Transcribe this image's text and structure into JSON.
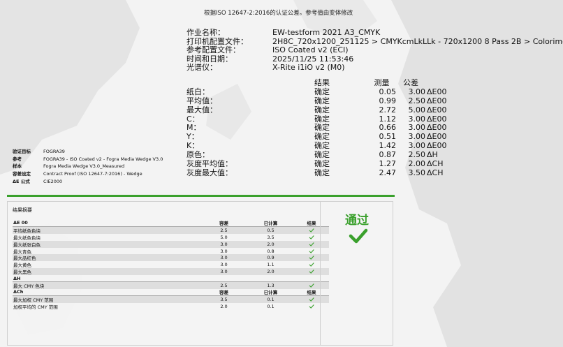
{
  "header_note": "根据ISO 12647-2:2016的认证公差。参考值由变体修改",
  "info": [
    {
      "label": "作业名称：",
      "value": "EW-testform 2021 A3_CMYK"
    },
    {
      "label": "打印机配置文件：",
      "value": "2H8C_720x1200_251125 > CMYKcmLkLLk - 720x1200 8 Pass 2B > Colorimetric"
    },
    {
      "label": "参考配置文件：",
      "value": "ISO Coated v2 (ECI)"
    },
    {
      "label": "时间和日期：",
      "value": "2025/11/25 11:53:46"
    },
    {
      "label": "光谱仪：",
      "value": "X-Rite i1iO v2 (M0)"
    }
  ],
  "measure_header": {
    "result": "结果",
    "measured": "测量",
    "tolerance": "公差"
  },
  "measurements": [
    {
      "label": "纸白：",
      "result": "确定",
      "measured": "0.05",
      "tolerance": "3.00",
      "unit": "ΔE00"
    },
    {
      "label": "平均值：",
      "result": "确定",
      "measured": "0.99",
      "tolerance": "2.50",
      "unit": "ΔE00"
    },
    {
      "label": "最大值：",
      "result": "确定",
      "measured": "2.72",
      "tolerance": "5.00",
      "unit": "ΔE00"
    },
    {
      "label": "C：",
      "result": "确定",
      "measured": "1.12",
      "tolerance": "3.00",
      "unit": "ΔE00"
    },
    {
      "label": "M：",
      "result": "确定",
      "measured": "0.66",
      "tolerance": "3.00",
      "unit": "ΔE00"
    },
    {
      "label": "Y：",
      "result": "确定",
      "measured": "0.51",
      "tolerance": "3.00",
      "unit": "ΔE00"
    },
    {
      "label": "K：",
      "result": "确定",
      "measured": "1.42",
      "tolerance": "3.00",
      "unit": "ΔE00"
    },
    {
      "label": "原色：",
      "result": "确定",
      "measured": "0.87",
      "tolerance": "2.50",
      "unit": "ΔH"
    },
    {
      "label": "灰度平均值：",
      "result": "确定",
      "measured": "1.27",
      "tolerance": "2.00",
      "unit": "ΔCH"
    },
    {
      "label": "灰度最大值：",
      "result": "确定",
      "measured": "2.47",
      "tolerance": "3.50",
      "unit": "ΔCH"
    }
  ],
  "small_info": [
    {
      "label": "验证目标",
      "value": "FOGRA39"
    },
    {
      "label": "参考",
      "value": "FOGRA39 - ISO Coated v2 - Fogra Media Wedge V3.0"
    },
    {
      "label": "样本",
      "value": "Fogra Media Wedge V3.0_Measured"
    },
    {
      "label": "容差设定",
      "value": "Contract Proof (ISO 12647-7:2016) - Wedge"
    },
    {
      "label": "ΔE 公式",
      "value": "CIE2000"
    }
  ],
  "summary": {
    "title": "结果摘要",
    "pass_label": "通过",
    "rows": [
      {
        "kind": "section",
        "name": "ΔE 00",
        "target": "容差",
        "measured": "已计算",
        "result": "结果"
      },
      {
        "kind": "data",
        "name": "平均纸色色块",
        "target": "2.5",
        "measured": "0.5",
        "pass": true
      },
      {
        "kind": "data",
        "name": "最大纸色色块",
        "target": "5.0",
        "measured": "3.5",
        "pass": true
      },
      {
        "kind": "data",
        "name": "最大纸张白色",
        "target": "3.0",
        "measured": "2.0",
        "pass": true
      },
      {
        "kind": "data",
        "name": "最大青色",
        "target": "3.0",
        "measured": "0.8",
        "pass": true
      },
      {
        "kind": "data",
        "name": "最大品红色",
        "target": "3.0",
        "measured": "0.9",
        "pass": true
      },
      {
        "kind": "data",
        "name": "最大黄色",
        "target": "3.0",
        "measured": "1.1",
        "pass": true
      },
      {
        "kind": "data",
        "name": "最大黑色",
        "target": "3.0",
        "measured": "2.0",
        "pass": true
      },
      {
        "kind": "section",
        "name": "ΔH",
        "target": "",
        "measured": "",
        "result": ""
      },
      {
        "kind": "data",
        "name": "最大 CMY 色块",
        "target": "2.5",
        "measured": "1.3",
        "pass": true
      },
      {
        "kind": "section",
        "name": "ΔCh",
        "target": "容差",
        "measured": "已计算",
        "result": "结果"
      },
      {
        "kind": "data",
        "name": "最大加权 CMY 范围",
        "target": "3.5",
        "measured": "0.1",
        "pass": true
      },
      {
        "kind": "data",
        "name": "加权平均的 CMY 范围",
        "target": "2.0",
        "measured": "0.1",
        "pass": true
      }
    ]
  },
  "colors": {
    "pass_green": "#3aa02c",
    "row_shade": "#dedede"
  }
}
